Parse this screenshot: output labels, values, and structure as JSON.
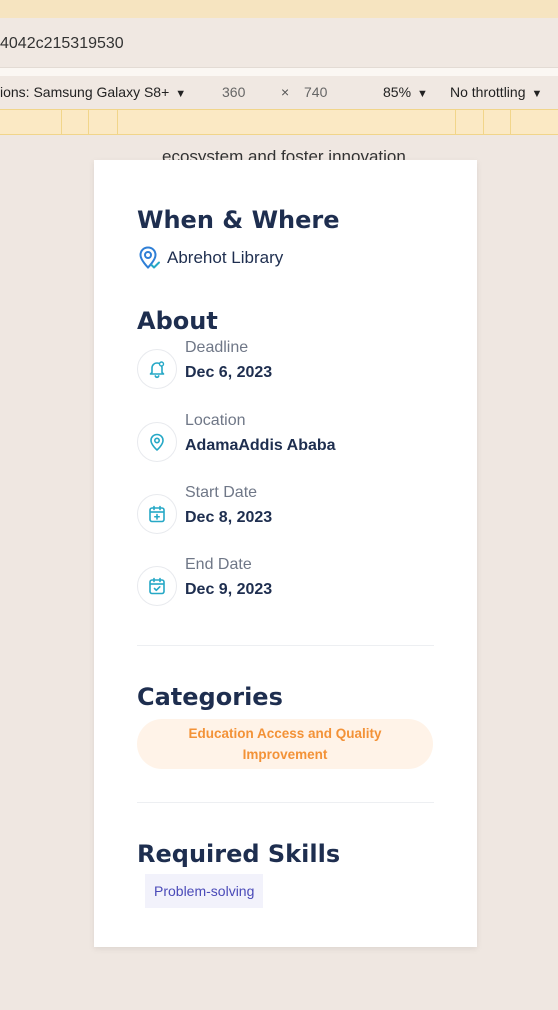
{
  "browser": {
    "url_fragment": "4042c215319530"
  },
  "device_toolbar": {
    "device_label": "ions: Samsung Galaxy S8+",
    "width": "360",
    "times": "×",
    "height": "740",
    "zoom": "85%",
    "throttling": "No throttling"
  },
  "page": {
    "cut_text": "ecosystem and foster innovation.",
    "when_where": {
      "heading": "When & Where",
      "location": "Abrehot Library"
    },
    "about": {
      "heading": "About",
      "items": [
        {
          "label": "Deadline",
          "value": "Dec 6, 2023",
          "icon": "bell-icon"
        },
        {
          "label": "Location",
          "value": "AdamaAddis Ababa",
          "icon": "location-pin-icon"
        },
        {
          "label": "Start Date",
          "value": "Dec 8, 2023",
          "icon": "calendar-plus-icon"
        },
        {
          "label": "End Date",
          "value": "Dec 9, 2023",
          "icon": "calendar-check-icon"
        }
      ]
    },
    "categories": {
      "heading": "Categories",
      "items": [
        "Education Access and Quality Improvement"
      ]
    },
    "skills": {
      "heading": "Required Skills",
      "items": [
        "Problem-solving"
      ]
    }
  },
  "colors": {
    "heading": "#1e2e4f",
    "icon_accent": "#26a8c6",
    "category_bg": "#fff3e8",
    "category_text": "#f39237",
    "skill_bg": "#f2f2fb",
    "skill_text": "#4a4ab8"
  }
}
